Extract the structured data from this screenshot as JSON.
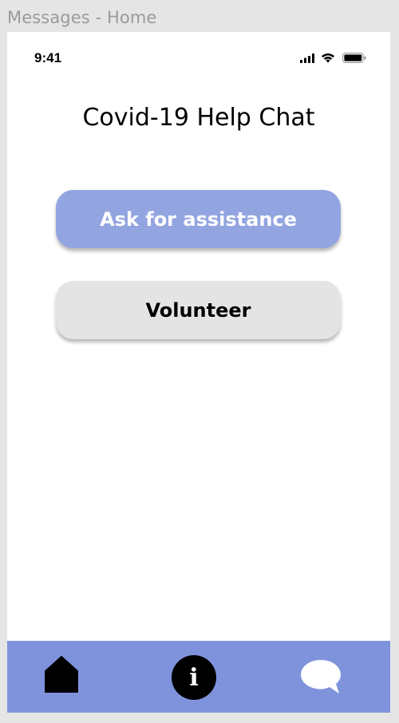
{
  "window": {
    "frame_title": "Messages - Home"
  },
  "status_bar": {
    "time": "9:41",
    "icons": [
      "cellular-signal-icon",
      "wifi-icon",
      "battery-icon"
    ]
  },
  "header": {
    "title": "Covid-19 Help Chat"
  },
  "actions": {
    "assist_label": "Ask for assistance",
    "volunteer_label": "Volunteer"
  },
  "tab_bar": {
    "items": [
      {
        "name": "home",
        "icon": "home-icon"
      },
      {
        "name": "info",
        "icon": "info-icon",
        "glyph": "i"
      },
      {
        "name": "messages",
        "icon": "chat-bubble-icon"
      }
    ]
  },
  "colors": {
    "primary_button": "#93a5e0",
    "secondary_button": "#e4e4e4",
    "tab_bar": "#7f93dd"
  }
}
